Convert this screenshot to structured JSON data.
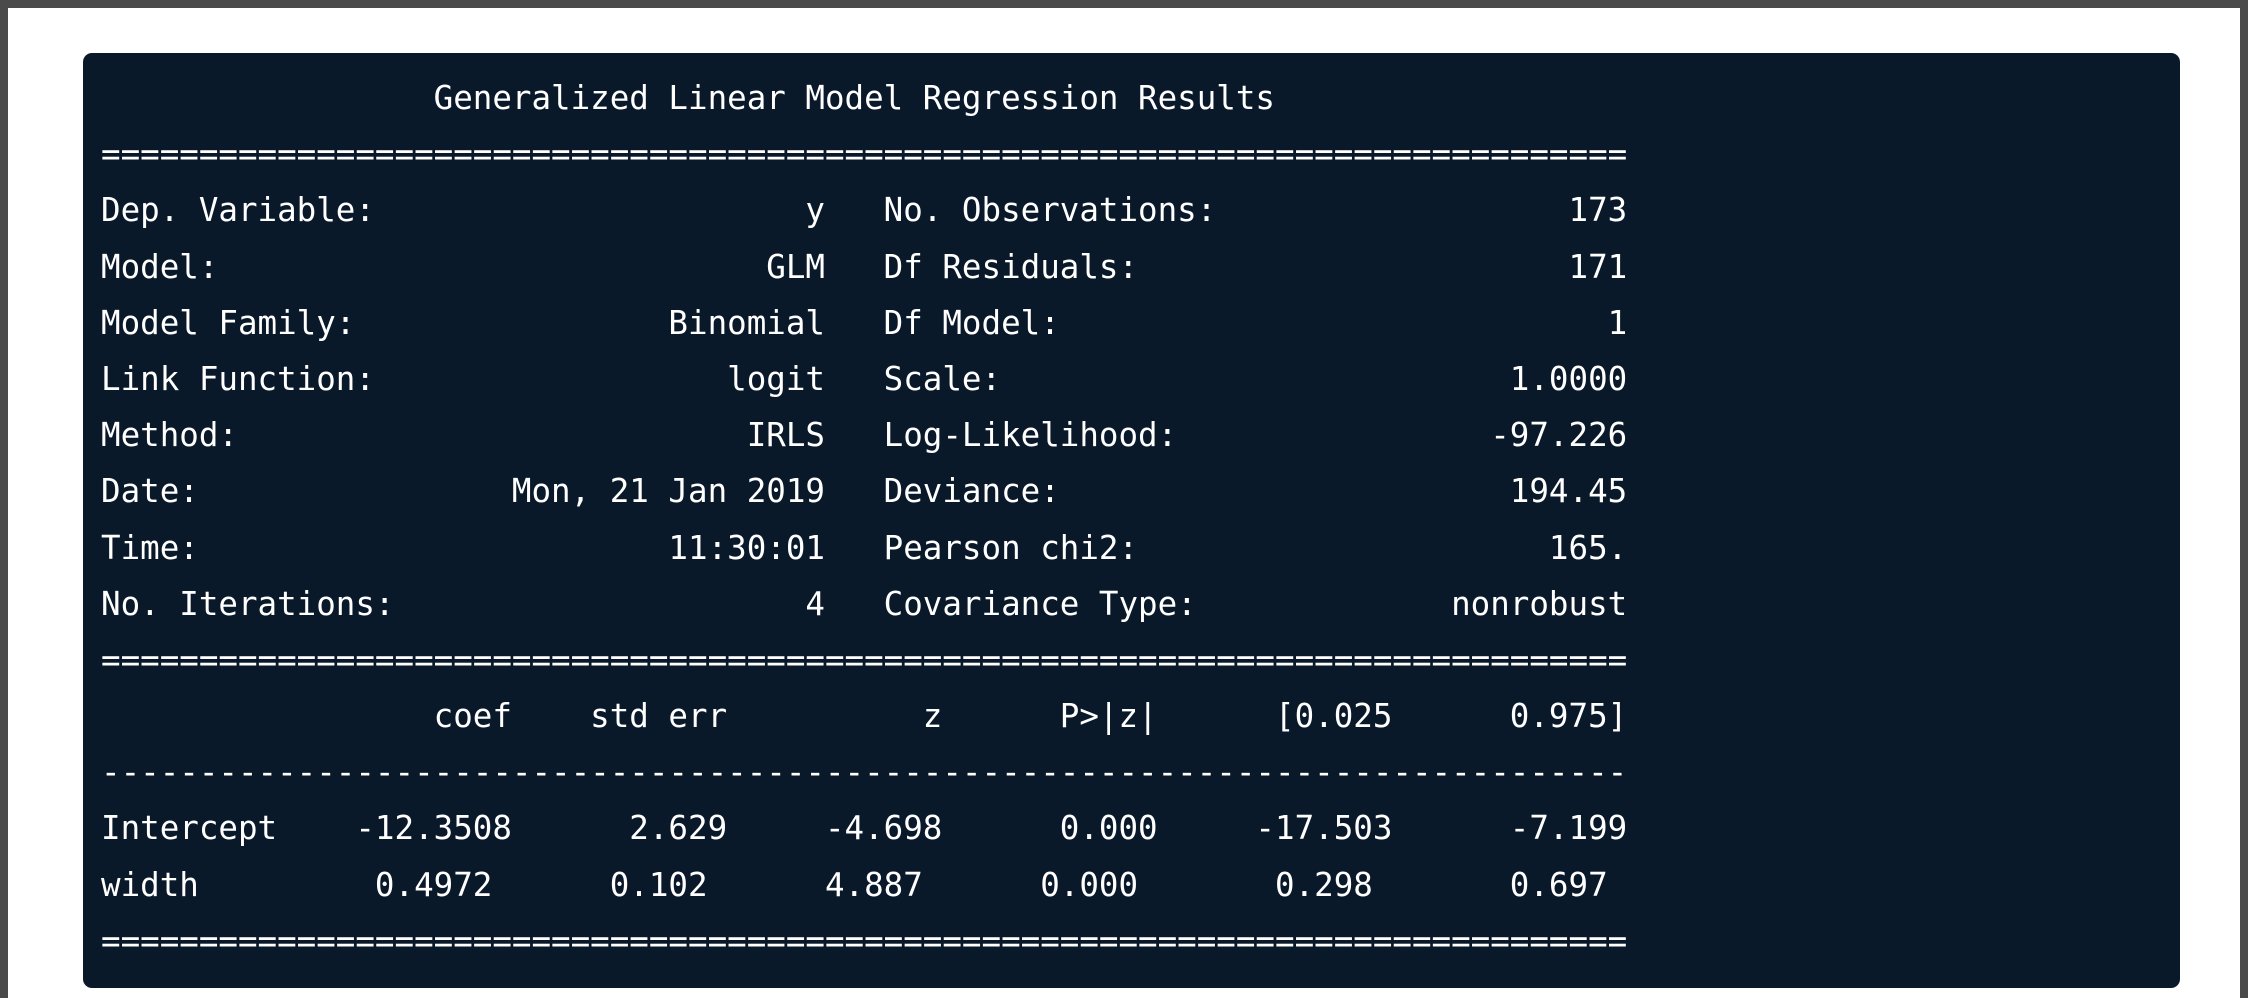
{
  "summary": {
    "lines": [
      "                 Generalized Linear Model Regression Results                  ",
      "==============================================================================",
      "Dep. Variable:                      y   No. Observations:                  173",
      "Model:                            GLM   Df Residuals:                      171",
      "Model Family:                Binomial   Df Model:                            1",
      "Link Function:                  logit   Scale:                          1.0000",
      "Method:                          IRLS   Log-Likelihood:                -97.226",
      "Date:                Mon, 21 Jan 2019   Deviance:                       194.45",
      "Time:                        11:30:01   Pearson chi2:                     165.",
      "No. Iterations:                     4   Covariance Type:             nonrobust",
      "==============================================================================",
      "                 coef    std err          z      P>|z|      [0.025      0.975]",
      "------------------------------------------------------------------------------",
      "Intercept    -12.3508      2.629     -4.698      0.000     -17.503      -7.199",
      "width         0.4972      0.102      4.887      0.000       0.298       0.697",
      "=============================================================================="
    ]
  }
}
